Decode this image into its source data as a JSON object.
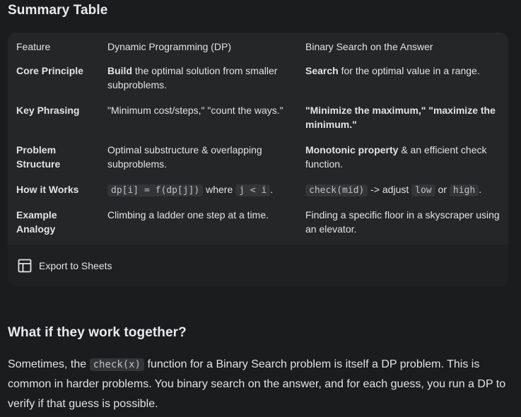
{
  "summary": {
    "title": "Summary Table"
  },
  "table": {
    "headers": [
      "Feature",
      "Dynamic Programming (DP)",
      "Binary Search on the Answer"
    ],
    "rows": [
      {
        "feature": "Core Principle",
        "dp_bold": "Build",
        "dp_rest": " the optimal solution from smaller subproblems.",
        "bs_bold": "Search",
        "bs_rest": " for the optimal value in a range."
      },
      {
        "feature": "Key Phrasing",
        "dp_text": "\"Minimum cost/steps,\" \"count the ways.\"",
        "bs_bold": "\"Minimize the maximum,\" \"maximize the minimum.\""
      },
      {
        "feature": "Problem Structure",
        "dp_text": "Optimal substructure & overlapping subproblems.",
        "bs_bold": "Monotonic property",
        "bs_rest": " & an efficient check function."
      },
      {
        "feature": "How it Works",
        "dp_code1": "dp[i] = f(dp[j])",
        "dp_mid": " where ",
        "dp_code2": "j < i",
        "dp_end": ".",
        "bs_code1": "check(mid)",
        "bs_mid1": " -> adjust ",
        "bs_code2": "low",
        "bs_mid2": " or ",
        "bs_code3": "high",
        "bs_end": "."
      },
      {
        "feature": "Example Analogy",
        "dp_text": "Climbing a ladder one step at a time.",
        "bs_text": "Finding a specific floor in a skyscraper using an elevator."
      }
    ]
  },
  "export": {
    "label": "Export to Sheets",
    "icon": "table-grid-icon"
  },
  "together": {
    "title": "What if they work together?",
    "p_start": "Sometimes, the ",
    "p_code": "check(x)",
    "p_end": " function for a Binary Search problem is itself a DP problem. This is common in harder problems. You binary search on the answer, and for each guess, you run a DP to verify if that guess is possible."
  }
}
